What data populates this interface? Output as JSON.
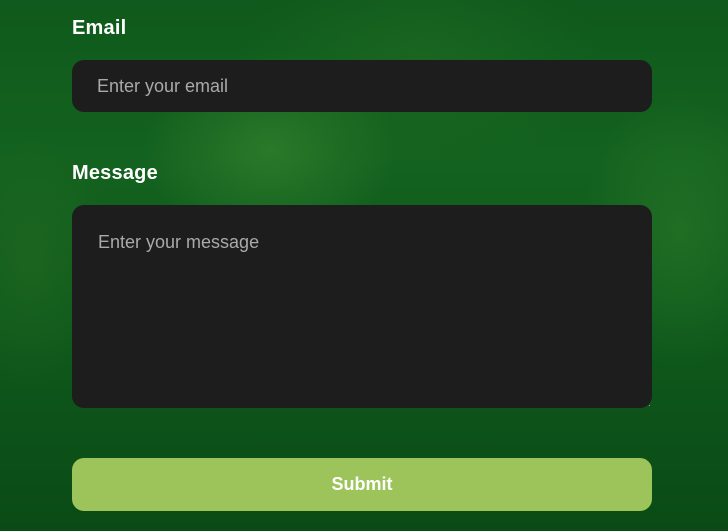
{
  "form": {
    "email": {
      "label": "Email",
      "placeholder": "Enter your email",
      "value": ""
    },
    "message": {
      "label": "Message",
      "placeholder": "Enter your message",
      "value": ""
    },
    "submit_label": "Submit"
  },
  "colors": {
    "background": "#0f5a1c",
    "field_background": "#1d1d1d",
    "submit_background": "#9dc45a",
    "label_text": "#ffffff",
    "placeholder_text": "#a9a9a9"
  }
}
